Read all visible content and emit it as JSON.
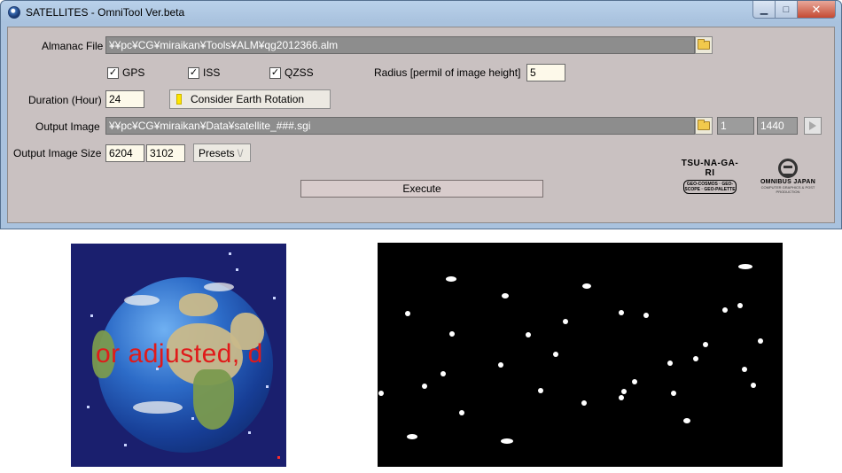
{
  "window": {
    "title": "SATELLITES - OmniTool Ver.beta",
    "controls": {
      "minimize": "▁",
      "maximize": "□",
      "close": "✕"
    }
  },
  "form": {
    "almanac_label": "Almanac File",
    "almanac_value": "¥¥pc¥CG¥miraikan¥Tools¥ALM¥qg2012366.alm",
    "checkboxes": [
      {
        "label": "GPS",
        "checked": true,
        "mark": "✓"
      },
      {
        "label": "ISS",
        "checked": true,
        "mark": "✓"
      },
      {
        "label": "QZSS",
        "checked": true,
        "mark": "✓"
      }
    ],
    "radius_label": "Radius [permil of image height]",
    "radius_value": "5",
    "duration_label": "Duration (Hour)",
    "duration_value": "24",
    "earth_rotation_label": "Consider Earth Rotation",
    "output_image_label": "Output Image",
    "output_image_value": "¥¥pc¥CG¥miraikan¥Data¥satellite_###.sgi",
    "frame_start": "1",
    "frame_end": "1440",
    "output_size_label": "Output Image Size",
    "width_value": "6204",
    "height_value": "3102",
    "presets_label": "Presets",
    "presets_arrow": "\\/",
    "execute_label": "Execute"
  },
  "logos": {
    "tsunagari": "TSU-NA-GA-RI",
    "tsunagari_sub": "GEO-COSMOS · GEO-SCOPE · GEO-PALETTE",
    "omnibus": "OMNIBUS JAPAN",
    "omnibus_sub": "COMPUTER GRAPHICS & POST PRODUCTION"
  },
  "earth_preview": {
    "overlay_text": "or adjusted, d",
    "overlay_color": "#e01a1a"
  },
  "satellite_preview": {
    "background": "#000000",
    "dot_color": "#ffffff"
  }
}
